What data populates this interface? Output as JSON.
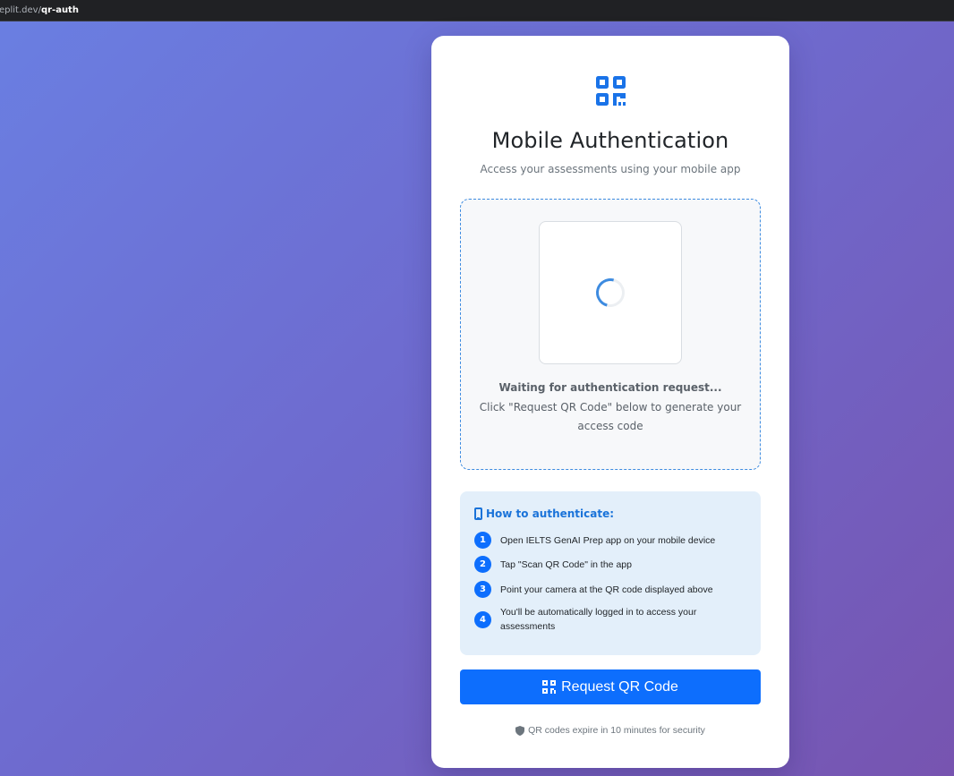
{
  "browser": {
    "url_prefix": "eplit.dev/",
    "url_path": "qr-auth"
  },
  "header": {
    "logo_icon": "qrcode-icon",
    "title": "Mobile Authentication",
    "subtitle": "Access your assessments using your mobile app"
  },
  "qr_panel": {
    "status_title": "Waiting for authentication request...",
    "status_desc": "Click \"Request QR Code\" below to generate your access code"
  },
  "howto": {
    "icon": "phone-icon",
    "heading": "How to authenticate:",
    "steps": [
      {
        "num": "1",
        "text": "Open IELTS GenAI Prep app on your mobile device"
      },
      {
        "num": "2",
        "text": "Tap \"Scan QR Code\" in the app"
      },
      {
        "num": "3",
        "text": "Point your camera at the QR code displayed above"
      },
      {
        "num": "4",
        "text": "You'll be automatically logged in to access your assessments"
      }
    ]
  },
  "actions": {
    "request_label": "Request QR Code"
  },
  "footer": {
    "note": "QR codes expire in 10 minutes for security"
  },
  "colors": {
    "primary": "#0d6efd",
    "background_start": "#6a7fe2",
    "background_end": "#7754b0"
  }
}
